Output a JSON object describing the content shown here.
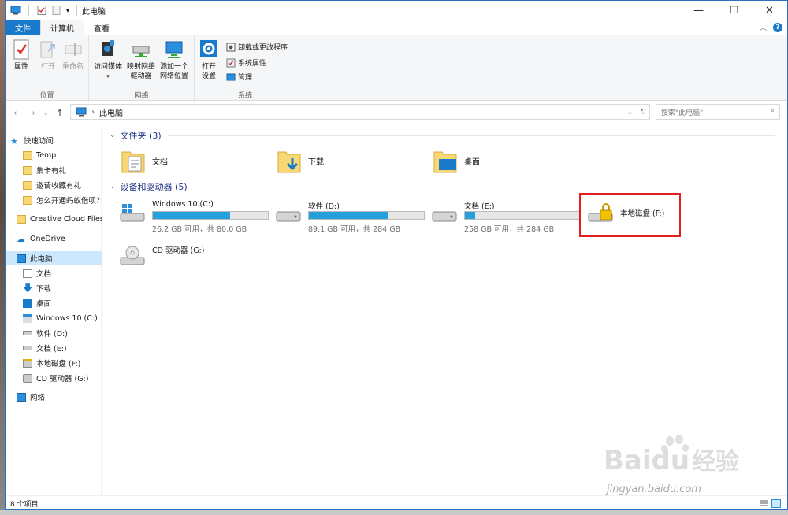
{
  "window": {
    "title": "此电脑",
    "buttons": {
      "minimize": "—",
      "maximize": "☐",
      "close": "✕"
    }
  },
  "tabs": {
    "file": "文件",
    "computer": "计算机",
    "view": "查看"
  },
  "ribbon": {
    "location_group": {
      "label": "位置",
      "properties": "属性",
      "open": "打开",
      "rename": "重命名"
    },
    "network_group": {
      "label": "网络",
      "access_media": "访问媒体",
      "map_drive_1": "映射网络",
      "map_drive_2": "驱动器",
      "add_location_1": "添加一个",
      "add_location_2": "网络位置"
    },
    "system_group": {
      "label": "系统",
      "open_settings_1": "打开",
      "open_settings_2": "设置",
      "uninstall": "卸载或更改程序",
      "system_properties": "系统属性",
      "manage": "管理"
    }
  },
  "address": {
    "path": "此电脑",
    "search_placeholder": "搜索\"此电脑\""
  },
  "nav": {
    "quick_access": "快速访问",
    "items": [
      "Temp",
      "集卡有礼",
      "邀请收藏有礼",
      "怎么开通蚂蚁借呗？"
    ],
    "creative_cloud": "Creative Cloud Files",
    "onedrive": "OneDrive",
    "this_pc": "此电脑",
    "pc_items": [
      "文档",
      "下载",
      "桌面",
      "Windows 10 (C:)",
      "软件 (D:)",
      "文档 (E:)",
      "本地磁盘 (F:)",
      "CD 驱动器 (G:)"
    ],
    "network": "网络"
  },
  "content": {
    "folders_header": "文件夹 (3)",
    "folders": [
      "文档",
      "下载",
      "桌面"
    ],
    "drives_header": "设备和驱动器 (5)",
    "drives": [
      {
        "name": "Windows 10 (C:)",
        "free": "26.2 GB 可用，共 80.0 GB",
        "used_fraction": 0.67
      },
      {
        "name": "软件 (D:)",
        "free": "89.1 GB 可用，共 284 GB",
        "used_fraction": 0.69
      },
      {
        "name": "文档 (E:)",
        "free": "258 GB 可用，共 284 GB",
        "used_fraction": 0.09
      },
      {
        "name": "本地磁盘 (F:)"
      },
      {
        "name": "CD 驱动器 (G:)"
      }
    ]
  },
  "status": {
    "count": "8 个项目"
  },
  "watermark": {
    "brand": "Baidu经验",
    "url": "jingyan.baidu.com"
  },
  "colors": {
    "accent": "#1979ca",
    "bar_fill": "#26a0da",
    "highlight": "#e02020",
    "section_header": "#1e3287"
  }
}
